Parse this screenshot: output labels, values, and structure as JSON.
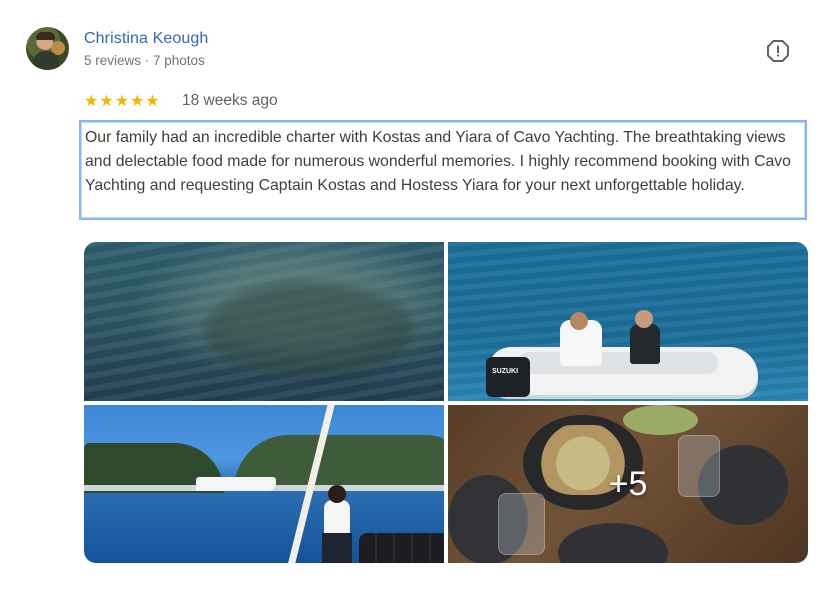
{
  "reviewer": {
    "name": "Christina Keough",
    "meta": "5 reviews · 7 photos",
    "avatar_icon": "avatar-photo"
  },
  "review": {
    "stars": "★★★★★",
    "rating": 5,
    "date": "18 weeks ago",
    "text": "Our family had an incredible charter with Kostas and Yiara of Cavo Yachting. The breathtaking views and delectable food made for numerous wonderful memories. I highly recommend booking with Cavo Yachting and requesting Captain Kostas and Hostess Yiara for your next unforgettable holiday."
  },
  "actions": {
    "report_icon": "report-icon"
  },
  "photos": {
    "more_label": "+5",
    "motor_brand": "SUZUKI"
  },
  "colors": {
    "name": "#3367b8",
    "star": "#f4b400",
    "focus_border": "#8ab4f8"
  }
}
